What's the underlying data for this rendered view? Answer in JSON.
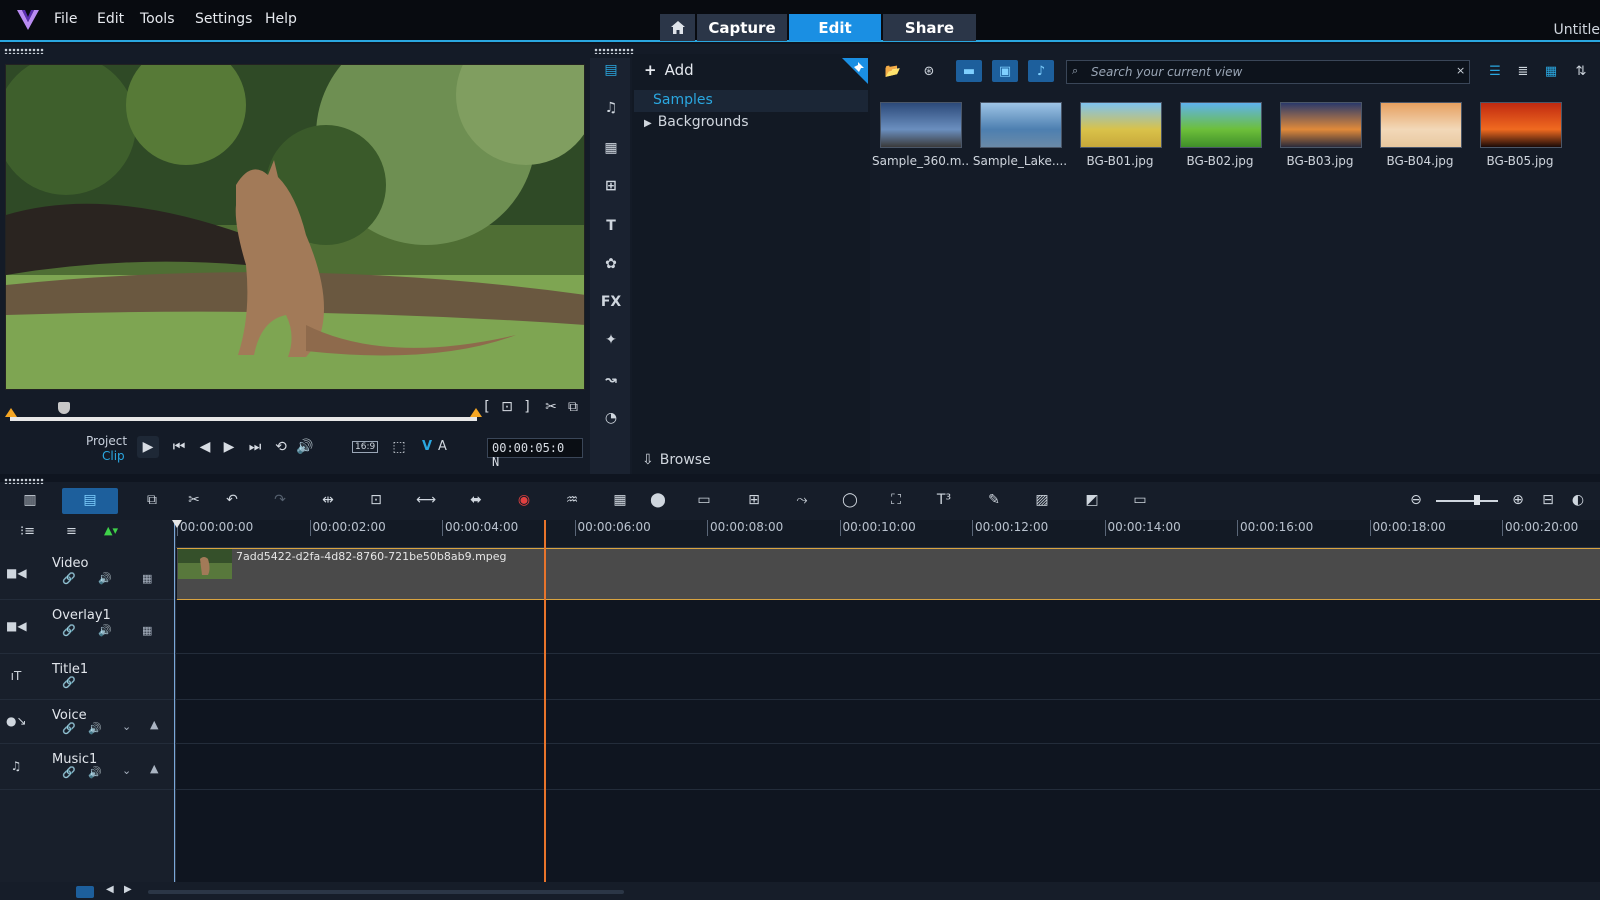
{
  "menu": {
    "file": "File",
    "edit": "Edit",
    "tools": "Tools",
    "settings": "Settings",
    "help": "Help"
  },
  "tabs": {
    "capture": "Capture",
    "edit": "Edit",
    "share": "Share"
  },
  "window": {
    "title": "Untitle"
  },
  "player": {
    "project_label": "Project",
    "clip_label": "Clip",
    "timecode": "00:00:05:0 N",
    "aspect": "16:9",
    "v_label": "V",
    "a_label": "A"
  },
  "library": {
    "add_label": "Add",
    "tree": {
      "samples": "Samples",
      "backgrounds": "Backgrounds"
    },
    "browse_label": "Browse",
    "search_placeholder": "Search your current view",
    "items": [
      {
        "name": "Sample_360.m...",
        "colors": [
          "#2c4a7a",
          "#6b8fbf",
          "#3a3a3a"
        ]
      },
      {
        "name": "Sample_Lake....",
        "colors": [
          "#9ec4e6",
          "#4d7fb0",
          "#6a8aa8"
        ]
      },
      {
        "name": "BG-B01.jpg",
        "colors": [
          "#7fc3f0",
          "#d9c24a",
          "#c7a83a"
        ]
      },
      {
        "name": "BG-B02.jpg",
        "colors": [
          "#5fb2ee",
          "#6dbf3a",
          "#3f8f2a"
        ]
      },
      {
        "name": "BG-B03.jpg",
        "colors": [
          "#2b3a6b",
          "#e08a3a",
          "#2a2a3a"
        ]
      },
      {
        "name": "BG-B04.jpg",
        "colors": [
          "#e6a060",
          "#f2d8b8",
          "#e8c8a0"
        ]
      },
      {
        "name": "BG-B05.jpg",
        "colors": [
          "#c02a10",
          "#f06a20",
          "#1a0a08"
        ]
      }
    ]
  },
  "timeline": {
    "ticks": [
      "00:00:00:00",
      "00:00:02:00",
      "00:00:04:00",
      "00:00:06:00",
      "00:00:08:00",
      "00:00:10:00",
      "00:00:12:00",
      "00:00:14:00",
      "00:00:16:00",
      "00:00:18:00",
      "00:00:20:00"
    ],
    "tracks": [
      {
        "name": "Video"
      },
      {
        "name": "Overlay1"
      },
      {
        "name": "Title1"
      },
      {
        "name": "Voice"
      },
      {
        "name": "Music1"
      }
    ],
    "clip_name": "7add5422-d2fa-4d82-8760-721be50b8ab9.mpeg"
  },
  "colors": {
    "accent": "#1a8fe3",
    "playhead": "#e8742b",
    "clip_border": "#d9a441"
  }
}
